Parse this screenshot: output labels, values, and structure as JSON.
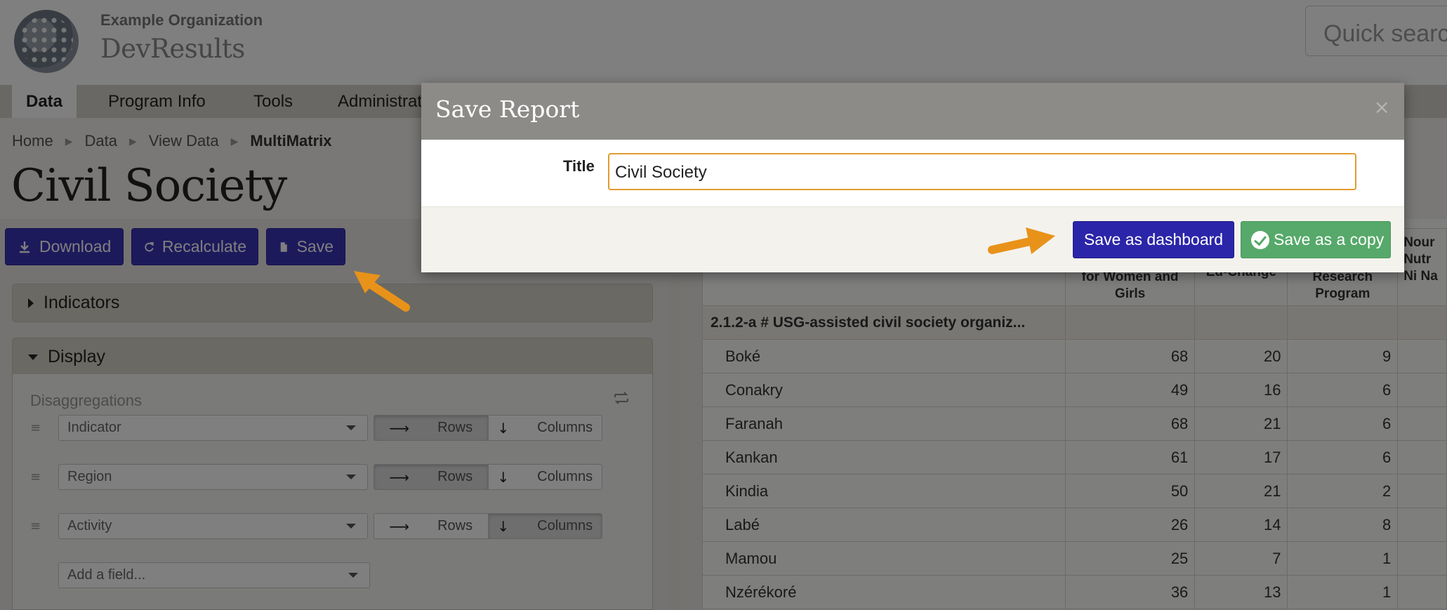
{
  "header": {
    "org_name": "Example Organization",
    "app_name": "DevResults",
    "quick_search_placeholder": "Quick search"
  },
  "nav": {
    "items": [
      {
        "label": "Data",
        "active": true
      },
      {
        "label": "Program Info"
      },
      {
        "label": "Tools"
      },
      {
        "label": "Administration"
      }
    ]
  },
  "breadcrumb": [
    "Home",
    "Data",
    "View Data",
    "MultiMatrix"
  ],
  "page_title": "Civil Society",
  "toolbar": {
    "download_label": "Download",
    "recalculate_label": "Recalculate",
    "save_label": "Save"
  },
  "panels": {
    "indicators_label": "Indicators",
    "display_label": "Display",
    "disaggregations_label": "Disaggregations",
    "rows": [
      {
        "field": "Indicator",
        "mode": "Rows"
      },
      {
        "field": "Region",
        "mode": "Rows"
      },
      {
        "field": "Activity",
        "mode": "Columns"
      }
    ],
    "rows_label": "Rows",
    "columns_label": "Columns",
    "add_field_placeholder": "Add a field..."
  },
  "table": {
    "headers": [
      {
        "label": "for Women and Girls"
      },
      {
        "label": "Ed-Change"
      },
      {
        "label": "Research Program"
      },
      {
        "label": "Nour Nutr Ni Na"
      }
    ],
    "group": "2.1.2-a # USG-assisted civil society organiz...",
    "rows": [
      {
        "name": "Boké",
        "v": [
          "68",
          "20",
          "9"
        ]
      },
      {
        "name": "Conakry",
        "v": [
          "49",
          "16",
          "6"
        ]
      },
      {
        "name": "Faranah",
        "v": [
          "68",
          "21",
          "6"
        ]
      },
      {
        "name": "Kankan",
        "v": [
          "61",
          "17",
          "6"
        ]
      },
      {
        "name": "Kindia",
        "v": [
          "50",
          "21",
          "2"
        ]
      },
      {
        "name": "Labé",
        "v": [
          "26",
          "14",
          "8"
        ]
      },
      {
        "name": "Mamou",
        "v": [
          "25",
          "7",
          "1"
        ]
      },
      {
        "name": "Nzérékoré",
        "v": [
          "36",
          "13",
          "1"
        ]
      }
    ]
  },
  "modal": {
    "title": "Save Report",
    "close_glyph": "×",
    "field_label": "Title",
    "field_value": "Civil Society",
    "save_dashboard_label": "Save as dashboard",
    "save_copy_label": "Save as a copy"
  },
  "colors": {
    "primary_button": "#3a34b8",
    "success_button": "#56a96a",
    "focus_border": "#e29b2f",
    "annotation_arrow": "#e8921a"
  }
}
